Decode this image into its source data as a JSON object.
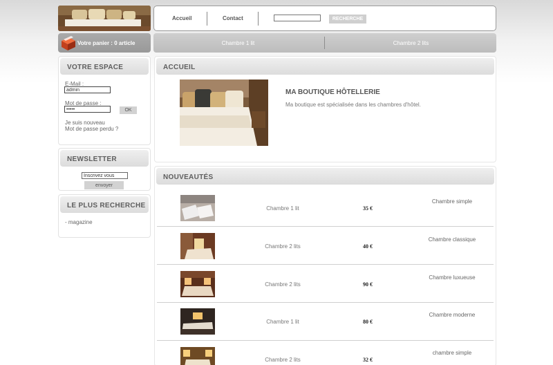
{
  "header": {
    "nav": [
      {
        "label": "Accueil"
      },
      {
        "label": "Contact"
      }
    ],
    "search": {
      "value": "",
      "button_label": "RECHERCHE"
    }
  },
  "cart": {
    "label": "Votre panier : 0 article"
  },
  "categories": [
    {
      "label": "Chambre 1 lit"
    },
    {
      "label": "Chambre 2 lits"
    }
  ],
  "sidebar": {
    "account": {
      "title": "VOTRE ESPACE",
      "email_label": "E-Mail :",
      "email_value": "admin",
      "password_label": "Mot de passe :",
      "password_value": "•••••",
      "ok_label": "OK",
      "register_link": "Je suis nouveau",
      "lost_password_link": "Mot de passe perdu ?"
    },
    "newsletter": {
      "title": "NEWSLETTER",
      "input_value": "Inscrivez vous",
      "button_label": "envoyer"
    },
    "popular": {
      "title": "LE PLUS RECHERCHE",
      "items": [
        "- magazine"
      ]
    }
  },
  "home": {
    "title": "ACCUEIL",
    "shop_title": "MA BOUTIQUE HÔTELLERIE",
    "shop_text": "Ma boutique est spécialisée dans les chambres d'hôtel."
  },
  "news": {
    "title": "NOUVEAUTÉS",
    "products": [
      {
        "name": "Chambre 1 lit",
        "price": "35 €",
        "desc": "Chambre simple"
      },
      {
        "name": "Chambre 2 lits",
        "price": "40 €",
        "desc": "Chambre classique"
      },
      {
        "name": "Chambre 2 lits",
        "price": "90 €",
        "desc": "Chambre luxueuse"
      },
      {
        "name": "Chambre 1 lit",
        "price": "80 €",
        "desc": "Chambre moderne"
      },
      {
        "name": "Chambre 2 lits",
        "price": "32 €",
        "desc": "chambre simple"
      }
    ]
  }
}
